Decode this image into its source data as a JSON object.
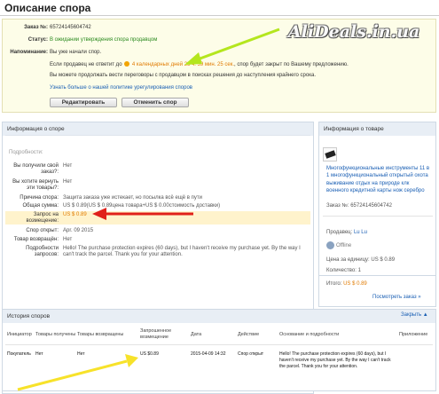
{
  "page": {
    "title": "Описание спора"
  },
  "watermark": "AliDeals.in.ua",
  "dispute": {
    "order_label": "Заказ №:",
    "order_no": "65724145604742",
    "status_label": "Статус:",
    "status_value": "В ожидании утверждения спора продавцом",
    "reminder_label": "Напоминание:",
    "reminder_line1": "Вы уже начали спор.",
    "reminder_line2a": "Если продавец не ответит до",
    "countdown": "4 календарных дней 23 ч. 59 мин. 25 сек.",
    "reminder_line2b": ", спор будет закрыт по Вашему предложению.",
    "reminder_line3": "Вы можете продолжать вести переговоры с продавцом в поисках решения до наступления крайнего срока.",
    "policy_link": "Узнать больше о нашей политике урегулирования споров",
    "edit_button": "Редактировать",
    "cancel_button": "Отменить спор"
  },
  "info": {
    "header": "Информация о споре",
    "details_label": "Подробности:",
    "rows": [
      {
        "label": "Вы получили свой заказ?:",
        "value": "Нет"
      },
      {
        "label": "Вы хотите вернуть эти товары?:",
        "value": "Нет"
      },
      {
        "label": "Причина спора:",
        "value": "Защита заказа уже истекает, но посылка всё ещё в пути"
      },
      {
        "label": "Общая сумма:",
        "value": "US $ 0.89(US $ 0.89цена товара+US $ 0.00стоимость доставки)"
      },
      {
        "label": "Запрос на возмещение:",
        "value": "US $ 0.89"
      },
      {
        "label": "Спор открыт:",
        "value": "Apr. 09 2015"
      },
      {
        "label": "Товар возвращён:",
        "value": "Нет"
      },
      {
        "label": "Подробности запросов:",
        "value": "Hello! The purchase protection expires (60 days), but I haven't receive my purchase yet. By the way I can't track the parcel. Thank you for your attention."
      }
    ]
  },
  "product": {
    "header": "Информация о товаре",
    "name": "Многофункциональные инструменты 11 в 1 многофункциональный открытый охота выживание отдых на природе клк военного кредитной карты нож серебро",
    "order_label": "Заказ №:",
    "order_no": "65724145604742",
    "seller_label": "Продавец:",
    "seller": "Lu Lu",
    "offline": "Offline",
    "unit_price_label": "Цена за единицу:",
    "unit_price": "US $ 0.89",
    "qty_label": "Количество:",
    "qty": "1",
    "total_label": "Итого:",
    "total": "US $ 0.89",
    "view_order": "Посмотреть заказ »"
  },
  "history": {
    "header": "История споров",
    "close_label": "Закрыть",
    "columns": [
      "Инициатор",
      "Товары получены",
      "Товары возвращены",
      "Запрошенное возмещение",
      "Дата",
      "Действие",
      "Основание и подробности",
      "Приложение"
    ],
    "rows": [
      {
        "initiator": "Покупатель",
        "received": "Нет",
        "returned": "Нет",
        "refund": "US $0.89",
        "date": "2015-04-09 14:32",
        "action": "Спор открыт",
        "details": "Hello! The purchase protection expires (60 days), but I haven't receive my purchase yet. By the way I can't track the parcel. Thank you for your attention.",
        "attachment": ""
      }
    ]
  },
  "colors": {
    "green": "#2b8a1f",
    "orange": "#e07a00",
    "link": "#1a5fb4",
    "highlight": "#fff3cc",
    "arrow_green": "#b4e61e",
    "arrow_red": "#e0201a",
    "arrow_yellow": "#f7e22a"
  }
}
